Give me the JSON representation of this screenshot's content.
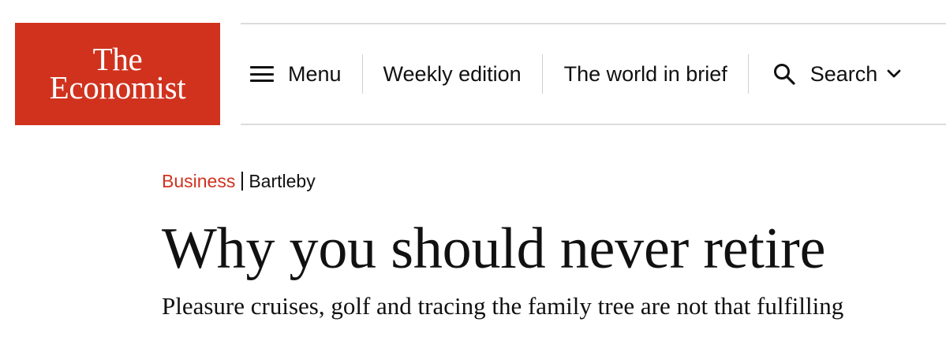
{
  "brand": {
    "line1": "The",
    "line2": "Economist",
    "color": "#d0321e"
  },
  "nav": {
    "menu_label": "Menu",
    "menu_icon": "hamburger-icon",
    "weekly_label": "Weekly edition",
    "brief_label": "The world in brief",
    "search_label": "Search",
    "search_icon": "search-icon",
    "search_chevron_icon": "chevron-down-icon"
  },
  "article": {
    "section": "Business",
    "column": "Bartleby",
    "headline": "Why you should never retire",
    "standfirst": "Pleasure cruises, golf and tracing the family tree are not that fulfilling"
  }
}
